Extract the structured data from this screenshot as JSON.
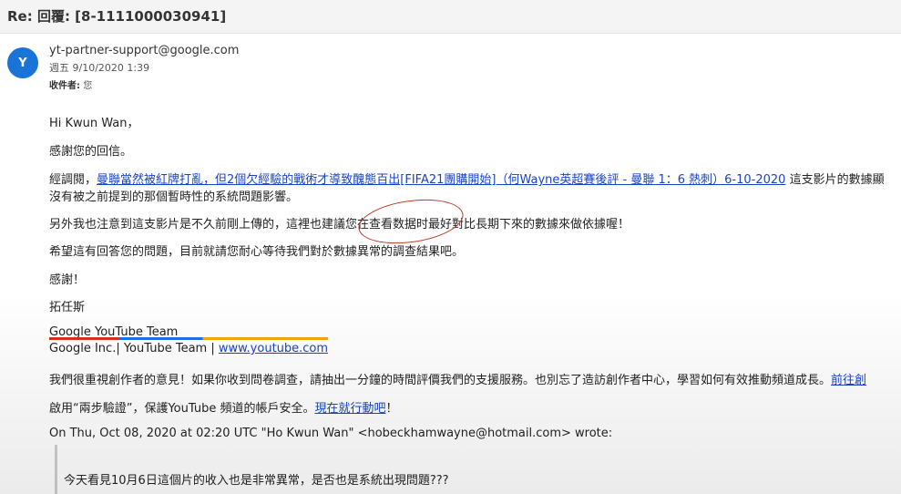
{
  "subject": "Re: 回覆: [8-1111000030941]",
  "avatar_initial": "Y",
  "sender": "yt-partner-support@google.com",
  "date": "週五 9/10/2020 1:39",
  "recipient_label": "收件者:",
  "recipient_value": "您",
  "greeting": "Hi Kwun Wan，",
  "thanks_reply": "感謝您的回信。",
  "para1_prefix": "經調閱，",
  "para1_link": "曼聯當然被紅牌打亂，但2個欠經驗的戰術才導致醜態百出[FIFA21團購開始]（何Wayne英超賽後評 - 曼聯 1：6 熱刺）6-10-2020",
  "para1_suffix": " 這支影片的數據顯",
  "para1_line2": "沒有被之前提到的那個暫時性的系統問題影響。",
  "para2": "另外我也注意到這支影片是不久前剛上傳的，這裡也建議您在查看数据时最好對比長期下來的數據來做依據喔！",
  "para3": "希望這有回答您的問題，目前就請您耐心等待我們對於數據異常的調查結果吧。",
  "thanks": "感謝！",
  "signoff_name": "拓任斯",
  "signature_team": "Google YouTube Team",
  "signature_inc": "Google Inc.| YouTube Team | ",
  "signature_link": "www.youtube.com",
  "feedback_text": "我們很重視創作者的意見！如果你收到問卷調查，請抽出一分鐘的時間評價我們的支援服務。也別忘了造訪創作者中心，學習如何有效推動頻道成長。",
  "feedback_link": "前往創",
  "twostep_text": "啟用“兩步驗證”，保護YouTube 頻道的帳戶安全。",
  "twostep_link": "現在就行動吧",
  "twostep_end": "！",
  "quote_header": "On Thu, Oct 08, 2020 at 02:20 UTC \"Ho Kwun Wan\" <hobeckhamwayne@hotmail.com> wrote:",
  "quoted_text": "今天看見10月6日這個片的收入也是非常異常，是否也是系統出現問題???",
  "colors": {
    "avatar": "#1a73d6",
    "link": "#1a43c8",
    "annotation_circle": "#c0392b"
  }
}
